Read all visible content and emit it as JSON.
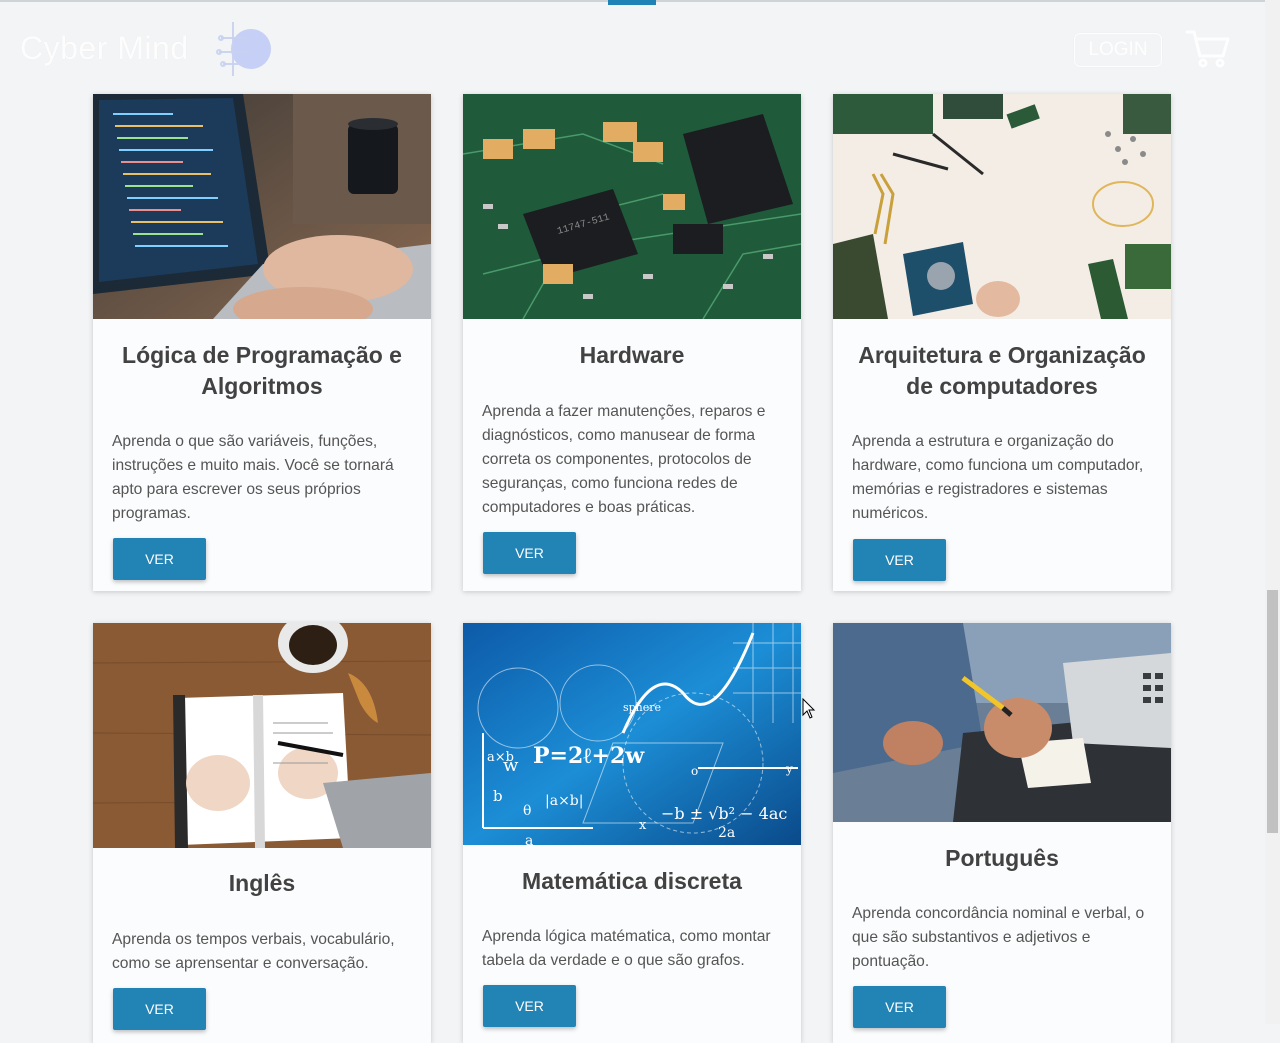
{
  "header": {
    "brand": "Cyber Mind",
    "login_label": "LOGIN"
  },
  "icons": {
    "brand": "brain-circuit-icon",
    "cart": "shopping-cart-icon"
  },
  "colors": {
    "accent": "#2283b5",
    "title": "#424242",
    "text": "#555555",
    "background": "#f2f4f6"
  },
  "courses": [
    {
      "title": "Lógica de Programação e Algoritmos",
      "description": "Aprenda o que são variáveis, funções, instruções e muito mais. Você se tornará apto para escrever os seus próprios programas.",
      "button": "VER",
      "image": "laptop-coding"
    },
    {
      "title": "Hardware",
      "description": "Aprenda a fazer manutenções, reparos e diagnósticos, como manusear de forma correta os componentes, protocolos de seguranças, como funciona redes de computadores e boas práticas.",
      "button": "VER",
      "image": "circuit-board"
    },
    {
      "title": "Arquitetura e Organização de computadores",
      "description": "Aprenda a estrutura e organização do hardware, como funciona um computador, memórias e registradores e sistemas numéricos.",
      "button": "VER",
      "image": "hardware-parts"
    },
    {
      "title": "Inglês",
      "description": "Aprenda os tempos verbais, vocabulário, como se aprensentar e conversação.",
      "button": "VER",
      "image": "notebook-writing"
    },
    {
      "title": "Matemática discreta",
      "description": "Aprenda lógica matématica, como montar tabela da verdade e o que são grafos.",
      "button": "VER",
      "image": "math-formulas"
    },
    {
      "title": "Português",
      "description": "Aprenda concordância nominal e verbal, o que são substantivos e adjetivos e pontuação.",
      "button": "VER",
      "image": "hand-writing-desk"
    }
  ],
  "math_image_text": {
    "formula_main": "P=2ℓ+2w",
    "formula_sqrt": "−b ± √b² − 4ac",
    "formula_den": "2a",
    "sphere": "sphere",
    "w": "w",
    "axb": "a×b",
    "abs": "|a×b|",
    "b": "b",
    "a": "a",
    "theta": "θ",
    "x": "x",
    "y": "y",
    "o": "o"
  }
}
